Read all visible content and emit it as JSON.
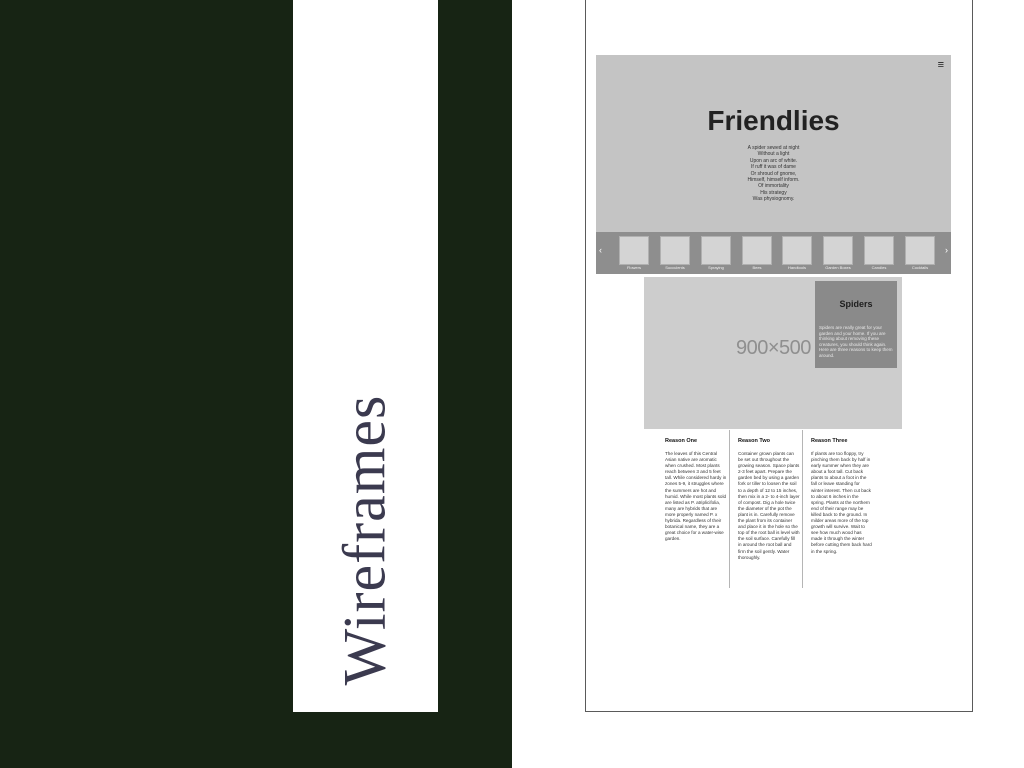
{
  "slide": {
    "title": "Wireframes"
  },
  "header": {
    "menu_icon": "≡",
    "title": "Friendlies",
    "poem": [
      "A spider sewed at night",
      "Without a light",
      "Upon an arc of white.",
      "If ruff it was of dame",
      "Or shroud of gnome,",
      "Himself, himself inform.",
      "Of immortality",
      "His strategy",
      "Was physiognomy."
    ]
  },
  "carousel": {
    "prev_icon": "‹",
    "next_icon": "›",
    "items": [
      {
        "label": "Flowers"
      },
      {
        "label": "Succulents"
      },
      {
        "label": "Spraying"
      },
      {
        "label": "Bees"
      },
      {
        "label": "Handtools"
      },
      {
        "label": "Garden Boxes"
      },
      {
        "label": "Candles"
      },
      {
        "label": "Cocktails"
      }
    ]
  },
  "feature": {
    "placeholder_size": "900×500",
    "card": {
      "title": "Spiders",
      "text": "Spiders are really great for your garden and your home. If you are thinking about removing these creatures, you should think again. Here are three reasons to keep them around."
    }
  },
  "reasons": [
    {
      "title": "Reason One",
      "text": "The leaves of this Central Asian native are aromatic when crushed. Most plants reach between 3 and 5 feet tall. While considered hardy in zones 5-9, it struggles where the summers are hot and humid. While most plants sold are listed as P. atriplicifolia, many are hybrids that are more properly named P. x hybrida. Regardless of their botanical name, they are a great choice for a water-wise garden."
    },
    {
      "title": "Reason Two",
      "text": "Container grown plants can be set out throughout the growing season. Space plants 2-3 feet apart. Prepare the garden bed by using a garden fork or tiller to loosen the soil to a depth of 12 to 15 inches, then mix in a 2- to 4-inch layer of compost. Dig a hole twice the diameter of the pot the plant is in. Carefully remove the plant from its container and place it in the hole so the top of the root ball is level with the soil surface. Carefully fill in around the root ball and firm the soil gently. Water thoroughly."
    },
    {
      "title": "Reason Three",
      "text": "If plants are too floppy, try pinching them back by half in early summer when they are about a foot tall. Cut back plants to about a foot in the fall or leave standing for winter interest. Then cut back to about 6 inches in the spring. Plants at the northern end of their range may be killed back to the ground. In milder areas more of the top growth will survive. Wait to see how much wood has made it through the winter before cutting them back hard in the spring."
    }
  ],
  "colors": {
    "slide_background": "#172414",
    "hero_background": "#c4c4c4",
    "carousel_background": "#8e8e8e",
    "card_background": "#8a8a8a"
  }
}
